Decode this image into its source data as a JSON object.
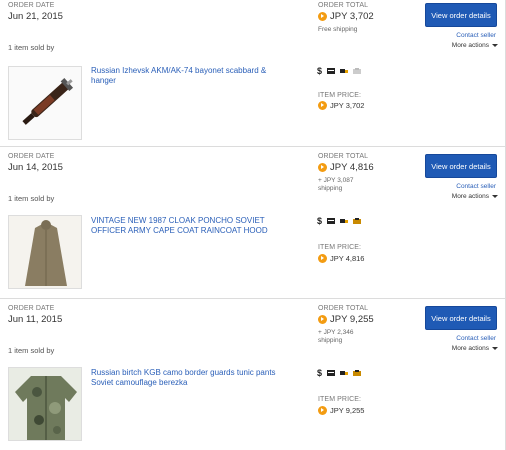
{
  "labels": {
    "order_date": "ORDER DATE",
    "order_total": "ORDER TOTAL",
    "item_price": "ITEM PRICE:",
    "view_order": "View order details",
    "contact_seller": "Contact seller",
    "more_actions": "More actions",
    "items_sold_by": "1 item sold by"
  },
  "orders": [
    {
      "date": "Jun 21, 2015",
      "total": "JPY 3,702",
      "shipping": "Free shipping",
      "title": "Russian Izhevsk AKM/AK-74 bayonet scabbard & hanger",
      "item_price": "JPY 3,702",
      "thumb_icon": "bayonet-thumbnail"
    },
    {
      "date": "Jun 14, 2015",
      "total": "JPY 4,816",
      "shipping": "+ JPY 3,087 shipping",
      "title": "VINTAGE NEW 1987 CLOAK PONCHO SOVIET OFFICER ARMY CAPE COAT RAINCOAT HOOD",
      "item_price": "JPY 4,816",
      "thumb_icon": "poncho-thumbnail"
    },
    {
      "date": "Jun 11, 2015",
      "total": "JPY 9,255",
      "shipping": "+ JPY 2,346 shipping",
      "title": "Russian birtch KGB camo border guards tunic pants Soviet camouflage berezka",
      "item_price": "JPY 9,255",
      "thumb_icon": "camo-tunic-thumbnail"
    }
  ],
  "status_icons": [
    "dollar-icon",
    "payment-icon",
    "shipped-icon",
    "feedback-icon"
  ],
  "colors": {
    "link": "#2a5fb8",
    "button": "#1f5ab5",
    "coin": "#f39c12"
  }
}
